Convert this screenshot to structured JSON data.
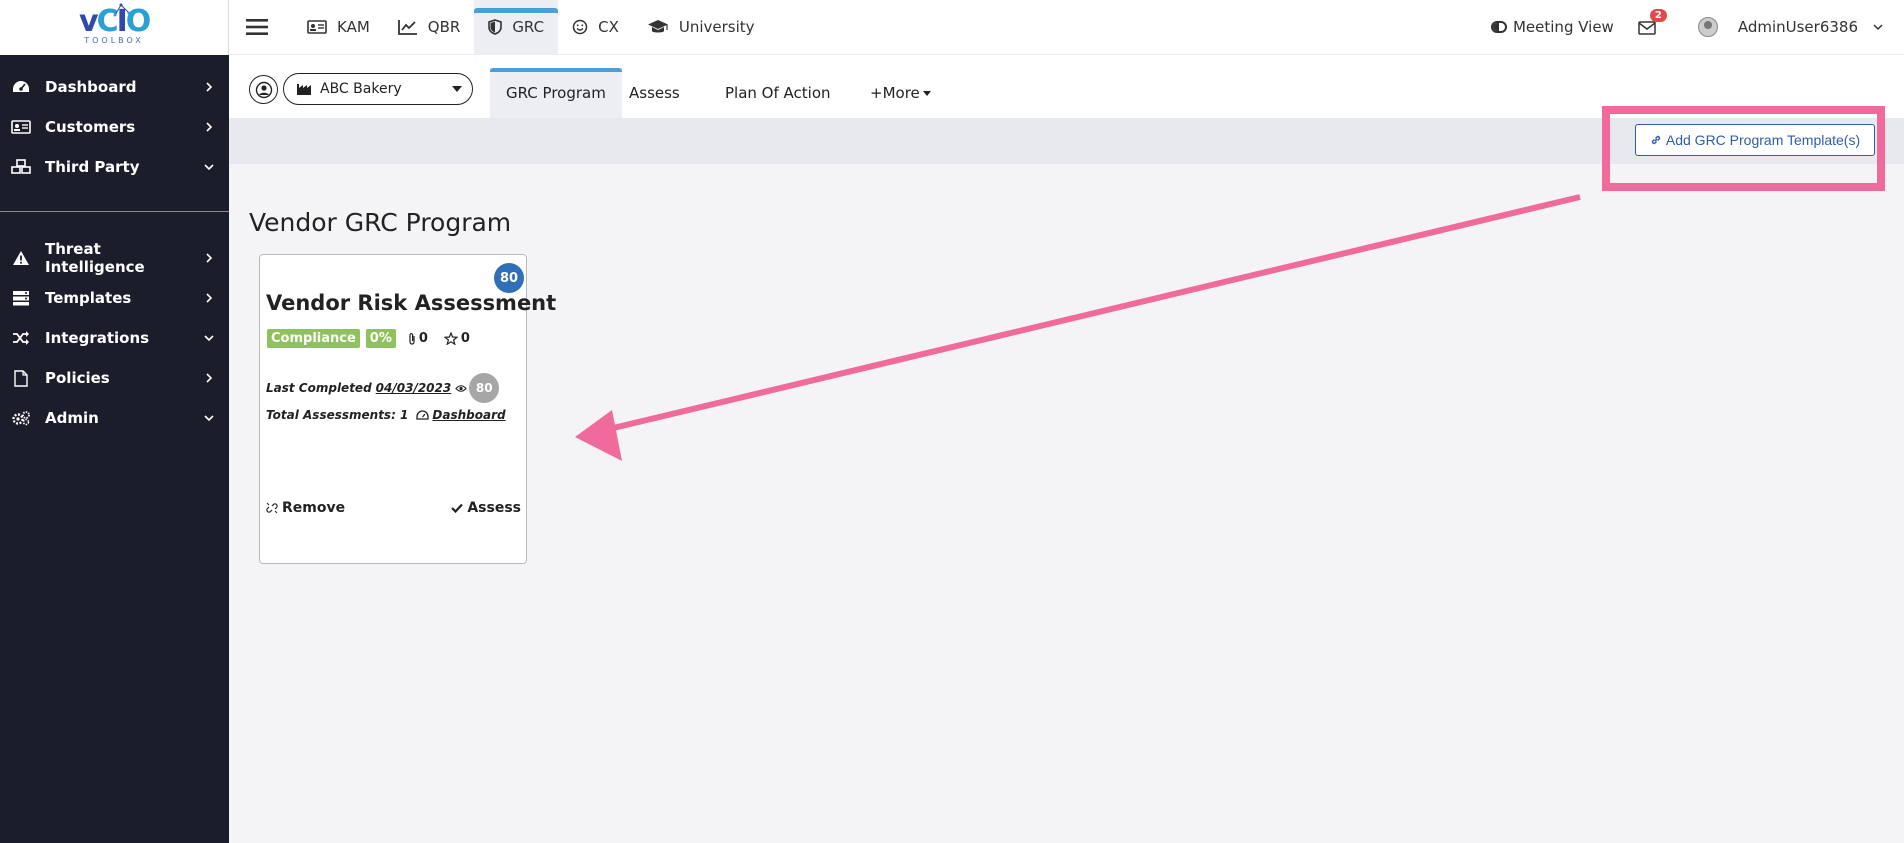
{
  "app": {
    "logo_text": "vCIO",
    "logo_sub": "TOOLBOX"
  },
  "sidebar": {
    "items": [
      {
        "label": "Dashboard",
        "icon": "dashboard-icon",
        "chevron": "right"
      },
      {
        "label": "Customers",
        "icon": "id-card-icon",
        "chevron": "right"
      },
      {
        "label": "Third Party",
        "icon": "cubes-icon",
        "chevron": "down"
      },
      {
        "label": "Threat Intelligence",
        "icon": "warning-icon",
        "chevron": "right"
      },
      {
        "label": "Templates",
        "icon": "server-icon",
        "chevron": "right"
      },
      {
        "label": "Integrations",
        "icon": "shuffle-icon",
        "chevron": "down"
      },
      {
        "label": "Policies",
        "icon": "file-icon",
        "chevron": "right"
      },
      {
        "label": "Admin",
        "icon": "gears-icon",
        "chevron": "down"
      }
    ]
  },
  "topbar": {
    "tabs": [
      {
        "label": "KAM",
        "icon": "id-card-icon"
      },
      {
        "label": "QBR",
        "icon": "line-chart-icon"
      },
      {
        "label": "GRC",
        "icon": "shield-icon",
        "active": true
      },
      {
        "label": "CX",
        "icon": "smile-icon"
      },
      {
        "label": "University",
        "icon": "graduation-cap-icon"
      }
    ],
    "meeting_view": "Meeting View",
    "mail_count": "2",
    "username": "AdminUser6386"
  },
  "subbar": {
    "customer": "ABC Bakery",
    "tabs": [
      "GRC Program",
      "Assess",
      "Plan Of Action",
      "+More"
    ]
  },
  "toolbar": {
    "add_button": "Add GRC Program Template(s)"
  },
  "main": {
    "title": "Vendor GRC Program",
    "card": {
      "score": "80",
      "title": "Vendor Risk Assessment",
      "compliance_label": "Compliance",
      "percent": "0%",
      "attachments": "0",
      "stars": "0",
      "last_completed_label": "Last Completed",
      "last_completed_date": "04/03/2023",
      "last_score": "80",
      "total_label": "Total Assessments: 1",
      "dashboard_link": "Dashboard",
      "remove_label": "Remove",
      "assess_label": "Assess"
    }
  },
  "colors": {
    "sidebar_bg": "#1c1d2b",
    "accent_blue": "#4a9fd9",
    "button_blue": "#2f5ea8",
    "annotation_pink": "#f06a9b",
    "compliance_green": "#8fc25f"
  }
}
